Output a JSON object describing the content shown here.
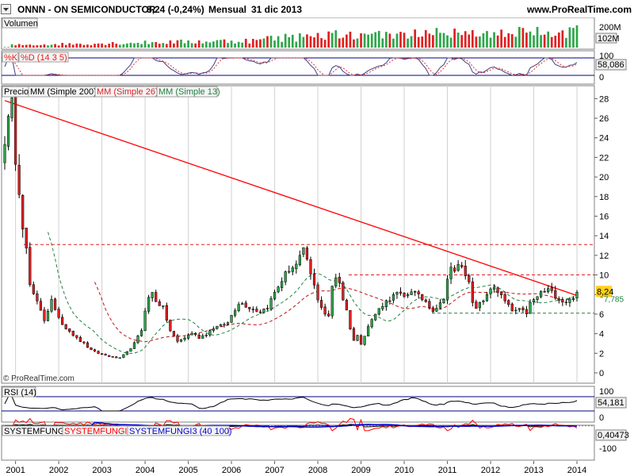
{
  "header": {
    "symbol": "ONNN - ON SEMICONDUCTOR",
    "price_change": "8,24 (-0,24%)",
    "period": "Mensual",
    "date": "31 dic 2013",
    "website": "www.ProRealTime.com"
  },
  "copyright": "© ProRealTime.com",
  "colors": {
    "bull": "#2ea64a",
    "bear": "#e02020",
    "volume_up": "#2ea64a",
    "volume_down": "#e02020",
    "mm200": "#000000",
    "mm26": "#c01010",
    "mm13": "#208040",
    "trend": "#ff0000",
    "grid": "#d0d0d0",
    "stoch_k": "#404080",
    "stoch_d": "#e03030",
    "rsi": "#000000",
    "sys1": "#000000",
    "sys2": "#ff0000",
    "sys3": "#0000cc",
    "panel_border": "#00007f"
  },
  "chart_data": [
    {
      "id": "volume",
      "type": "bar",
      "title": "Volumen",
      "y_ticks": [
        "200M"
      ],
      "last_value_label": "102M",
      "ylim": [
        0,
        250
      ],
      "unit": "M"
    },
    {
      "id": "stochastic",
      "type": "line",
      "title": "%K %D (14 3 5)",
      "labels": [
        "%K",
        "%D (14 3 5)"
      ],
      "y_ticks": [
        "100",
        "0"
      ],
      "last_value_label": "58,086",
      "ylim": [
        0,
        100
      ]
    },
    {
      "id": "price",
      "type": "candlestick",
      "legend": [
        "Precio",
        "MM (Simple 200)",
        "MM (Simple 26)",
        "MM (Simple 13)"
      ],
      "y_ticks": [
        "28",
        "26",
        "24",
        "22",
        "20",
        "18",
        "16",
        "14",
        "12",
        "10",
        "8",
        "6",
        "4",
        "2",
        "0"
      ],
      "ylim": [
        0,
        29
      ],
      "last_value_label": "8,24",
      "last_value_label2": "7,785",
      "x_labels": [
        "2001",
        "2002",
        "2003",
        "2004",
        "2005",
        "2006",
        "2007",
        "2008",
        "2009",
        "2010",
        "2011",
        "2012",
        "2013",
        "2014"
      ],
      "x_range": [
        2000.75,
        2014.0
      ],
      "horizontal_levels": [
        13.1,
        10.0,
        6.1
      ],
      "trendline": {
        "from": [
          2000.75,
          27.8
        ],
        "to": [
          2014.0,
          7.9
        ]
      },
      "anchors": [
        [
          2000.75,
          24.0
        ],
        [
          2000.92,
          27.3
        ],
        [
          2001.0,
          22.0
        ],
        [
          2001.08,
          19.0
        ],
        [
          2001.17,
          15.0
        ],
        [
          2001.25,
          12.5
        ],
        [
          2001.33,
          9.0
        ],
        [
          2001.42,
          7.8
        ],
        [
          2001.5,
          7.2
        ],
        [
          2001.58,
          6.5
        ],
        [
          2001.67,
          5.4
        ],
        [
          2001.75,
          6.4
        ],
        [
          2001.83,
          7.4
        ],
        [
          2001.92,
          6.2
        ],
        [
          2002.0,
          5.8
        ],
        [
          2002.08,
          5.0
        ],
        [
          2002.25,
          4.3
        ],
        [
          2002.42,
          3.5
        ],
        [
          2002.58,
          3.0
        ],
        [
          2002.75,
          2.3
        ],
        [
          2002.92,
          2.0
        ],
        [
          2003.08,
          1.8
        ],
        [
          2003.25,
          1.6
        ],
        [
          2003.42,
          1.5
        ],
        [
          2003.58,
          2.1
        ],
        [
          2003.75,
          3.0
        ],
        [
          2003.92,
          4.4
        ],
        [
          2004.0,
          6.5
        ],
        [
          2004.08,
          7.6
        ],
        [
          2004.17,
          8.2
        ],
        [
          2004.25,
          7.4
        ],
        [
          2004.42,
          6.6
        ],
        [
          2004.58,
          4.3
        ],
        [
          2004.75,
          3.2
        ],
        [
          2004.92,
          3.6
        ],
        [
          2005.08,
          4.1
        ],
        [
          2005.25,
          3.6
        ],
        [
          2005.42,
          4.0
        ],
        [
          2005.58,
          4.6
        ],
        [
          2005.75,
          4.8
        ],
        [
          2005.92,
          5.1
        ],
        [
          2006.0,
          5.9
        ],
        [
          2006.17,
          7.2
        ],
        [
          2006.33,
          6.9
        ],
        [
          2006.5,
          6.5
        ],
        [
          2006.67,
          6.3
        ],
        [
          2006.83,
          6.7
        ],
        [
          2007.0,
          8.2
        ],
        [
          2007.17,
          9.5
        ],
        [
          2007.33,
          10.6
        ],
        [
          2007.5,
          11.0
        ],
        [
          2007.67,
          12.4
        ],
        [
          2007.75,
          11.6
        ],
        [
          2007.83,
          10.0
        ],
        [
          2007.92,
          8.8
        ],
        [
          2008.0,
          7.6
        ],
        [
          2008.08,
          6.8
        ],
        [
          2008.17,
          6.0
        ],
        [
          2008.25,
          5.7
        ],
        [
          2008.33,
          8.8
        ],
        [
          2008.42,
          9.9
        ],
        [
          2008.5,
          9.3
        ],
        [
          2008.58,
          7.6
        ],
        [
          2008.67,
          6.3
        ],
        [
          2008.75,
          4.6
        ],
        [
          2008.83,
          3.3
        ],
        [
          2008.92,
          3.8
        ],
        [
          2009.0,
          3.0
        ],
        [
          2009.17,
          4.8
        ],
        [
          2009.33,
          6.0
        ],
        [
          2009.5,
          7.0
        ],
        [
          2009.67,
          7.6
        ],
        [
          2009.83,
          8.1
        ],
        [
          2010.0,
          7.7
        ],
        [
          2010.17,
          8.5
        ],
        [
          2010.33,
          7.8
        ],
        [
          2010.5,
          7.3
        ],
        [
          2010.67,
          6.4
        ],
        [
          2010.83,
          7.0
        ],
        [
          2010.92,
          7.8
        ],
        [
          2011.0,
          9.6
        ],
        [
          2011.08,
          10.6
        ],
        [
          2011.17,
          10.2
        ],
        [
          2011.25,
          11.2
        ],
        [
          2011.33,
          10.7
        ],
        [
          2011.5,
          9.6
        ],
        [
          2011.58,
          7.0
        ],
        [
          2011.67,
          6.5
        ],
        [
          2011.83,
          7.5
        ],
        [
          2011.92,
          7.8
        ],
        [
          2012.0,
          8.6
        ],
        [
          2012.08,
          8.9
        ],
        [
          2012.17,
          8.3
        ],
        [
          2012.33,
          7.3
        ],
        [
          2012.5,
          6.3
        ],
        [
          2012.67,
          6.4
        ],
        [
          2012.83,
          6.1
        ],
        [
          2012.92,
          7.1
        ],
        [
          2013.0,
          7.4
        ],
        [
          2013.17,
          8.2
        ],
        [
          2013.33,
          8.5
        ],
        [
          2013.5,
          7.9
        ],
        [
          2013.67,
          7.3
        ],
        [
          2013.83,
          7.4
        ],
        [
          2014.0,
          8.24
        ]
      ]
    },
    {
      "id": "rsi",
      "type": "line",
      "title": "RSI (14)",
      "y_ticks": [
        "100",
        "0"
      ],
      "last_value_label": "54,181",
      "ylim": [
        0,
        100
      ]
    },
    {
      "id": "systemfungi",
      "type": "line",
      "labels": [
        "SYSTEMFUNGI",
        "SYSTEMFUNGI2",
        "SYSTEMFUNGI3 (40 100)"
      ],
      "y_ticks": [
        "-100"
      ],
      "last_value_label": "0,40473",
      "ylim": [
        -120,
        40
      ]
    }
  ]
}
